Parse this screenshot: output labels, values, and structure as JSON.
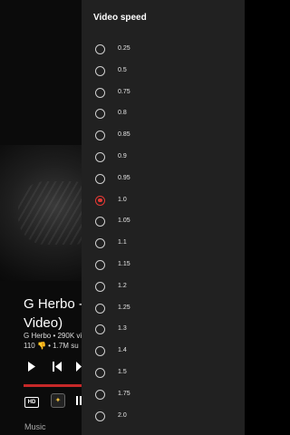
{
  "video": {
    "title": "G Herbo - Video)",
    "title_line1": "G Herbo - V",
    "title_line2": "Video)",
    "meta_line1": "G Herbo • 290K vi",
    "meta_line2": "110 👎 • 1.7M su",
    "section_label": "Music",
    "hd_label": "HD"
  },
  "speed_panel": {
    "title": "Video speed",
    "selected": "1.0",
    "options": [
      "0.25",
      "0.5",
      "0.75",
      "0.8",
      "0.85",
      "0.9",
      "0.95",
      "1.0",
      "1.05",
      "1.1",
      "1.15",
      "1.2",
      "1.25",
      "1.3",
      "1.4",
      "1.5",
      "1.75",
      "2.0"
    ]
  },
  "colors": {
    "accent": "#e53935",
    "panel_bg": "#212121",
    "progress": "#c62828"
  }
}
